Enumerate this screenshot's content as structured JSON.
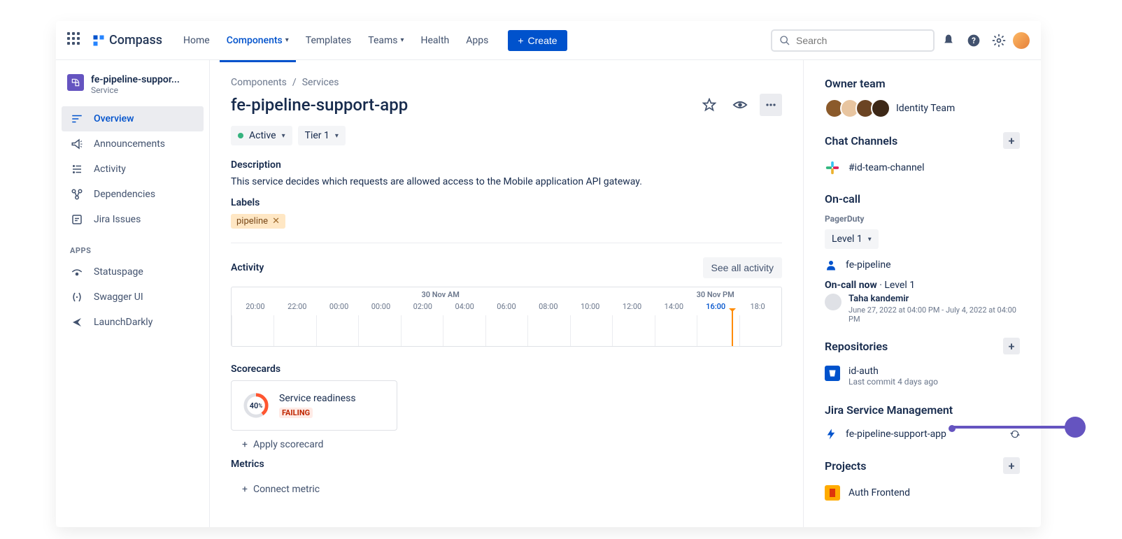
{
  "brand": "Compass",
  "nav": {
    "home": "Home",
    "components": "Components",
    "templates": "Templates",
    "teams": "Teams",
    "health": "Health",
    "apps": "Apps",
    "create": "Create",
    "search_placeholder": "Search"
  },
  "sidebar": {
    "title": "fe-pipeline-suppor...",
    "subtitle": "Service",
    "items": [
      {
        "label": "Overview"
      },
      {
        "label": "Announcements"
      },
      {
        "label": "Activity"
      },
      {
        "label": "Dependencies"
      },
      {
        "label": "Jira Issues"
      }
    ],
    "apps_heading": "APPS",
    "apps": [
      {
        "label": "Statuspage"
      },
      {
        "label": "Swagger UI"
      },
      {
        "label": "LaunchDarkly"
      }
    ]
  },
  "breadcrumb": {
    "a": "Components",
    "b": "Services"
  },
  "page": {
    "title": "fe-pipeline-support-app",
    "status": "Active",
    "tier": "Tier 1",
    "description_h": "Description",
    "description": "This service decides which requests are allowed access to the Mobile application API gateway.",
    "labels_h": "Labels",
    "label_val": "pipeline"
  },
  "activity": {
    "heading": "Activity",
    "see_all": "See all activity",
    "day_am": "30 Nov AM",
    "day_pm": "30 Nov PM",
    "hours": [
      "20:00",
      "22:00",
      "00:00",
      "00:00",
      "02:00",
      "04:00",
      "06:00",
      "08:00",
      "10:00",
      "12:00",
      "14:00",
      "16:00",
      "18:0"
    ],
    "current_index": 11
  },
  "scorecards": {
    "heading": "Scorecards",
    "percent": "40",
    "percent_suffix": "%",
    "title": "Service readiness",
    "badge": "FAILING",
    "apply": "Apply scorecard"
  },
  "metrics": {
    "heading": "Metrics",
    "connect": "Connect metric"
  },
  "right": {
    "owner_team_h": "Owner team",
    "team_name": "Identity Team",
    "chat_h": "Chat Channels",
    "chat_channel": "#id-team-channel",
    "oncall_h": "On-call",
    "pagerduty": "PagerDuty",
    "level": "Level 1",
    "oncall_service": "fe-pipeline",
    "oncall_now": "On-call now",
    "oncall_now_level": "Level 1",
    "oncall_name": "Taha kandemir",
    "oncall_time": "June 27, 2022 at 04:00 PM - July 4, 2022 at 04:00 PM",
    "repos_h": "Repositories",
    "repo_name": "id-auth",
    "repo_sub": "Last commit 4 days ago",
    "jsm_h": "Jira Service Management",
    "jsm_name": "fe-pipeline-support-app",
    "projects_h": "Projects",
    "project_name": "Auth Frontend"
  },
  "colors": {
    "av1": "#8B5A2B",
    "av2": "#E8C5A0",
    "av3": "#6B4423",
    "av4": "#3D2817"
  }
}
